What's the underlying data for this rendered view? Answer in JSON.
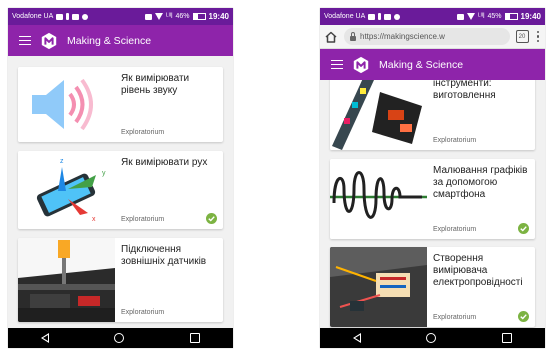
{
  "left_phone": {
    "status": {
      "carrier": "Vodafone UA",
      "signal": "ᴸᴵᴵl",
      "battery": "46%",
      "time": "19:40"
    },
    "appbar": {
      "title": "Making & Science"
    },
    "cards": [
      {
        "title": "Як вимірювати рівень звуку",
        "source": "Exploratorium",
        "completed": false
      },
      {
        "title": "Як вимірювати рух",
        "source": "Exploratorium",
        "completed": true
      },
      {
        "title": "Підключення зовнішніх датчиків",
        "source": "Exploratorium",
        "completed": false
      }
    ]
  },
  "right_phone": {
    "status": {
      "carrier": "Vodafone UA",
      "signal": "ᴸᴵᴵl",
      "battery": "45%",
      "time": "19:40"
    },
    "urlbar": {
      "url": "https://makingscience.w",
      "tabs_count": "20"
    },
    "appbar": {
      "title": "Making & Science"
    },
    "cards": [
      {
        "title": "інструменти: виготовлення",
        "source": "Exploratorium",
        "completed": false
      },
      {
        "title": "Малювання графіків за допомогою смартфона",
        "source": "Exploratorium",
        "completed": true
      },
      {
        "title": "Створення вимірювача електропровідності",
        "source": "Exploratorium",
        "completed": true
      }
    ]
  },
  "colors": {
    "status_bar": "#6a1b9a",
    "app_bar": "#8e24aa",
    "check": "#7cb342"
  },
  "icons": [
    "menu-icon",
    "app-logo-icon",
    "home-icon",
    "lock-icon",
    "tabs-icon",
    "overflow-menu-icon",
    "check-icon",
    "back-icon",
    "home-nav-icon",
    "recents-icon"
  ]
}
